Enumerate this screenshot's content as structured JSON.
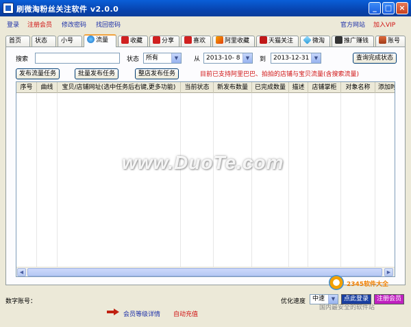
{
  "window": {
    "title": "刷微淘粉丝关注软件 v2.0.0"
  },
  "menu": {
    "login": "登录",
    "register": "注册会员",
    "change_password": "修改密码",
    "find_password": "找回密码",
    "official_site": "官方网站",
    "join_vip": "加入VIP"
  },
  "tabs": [
    {
      "label": "首页"
    },
    {
      "label": "状态"
    },
    {
      "label": "小号"
    },
    {
      "label": "流量"
    },
    {
      "label": "收藏"
    },
    {
      "label": "分享"
    },
    {
      "label": "喜欢"
    },
    {
      "label": "阿里收藏"
    },
    {
      "label": "天猫关注"
    },
    {
      "label": "微淘"
    },
    {
      "label": "推广赚钱"
    },
    {
      "label": "账号"
    }
  ],
  "filters": {
    "search_label": "搜索",
    "search_value": "",
    "status_label": "状态",
    "status_value": "所有",
    "from_label": "从",
    "from_date": "2013-10- 8",
    "to_label": "到",
    "to_date": "2013-12-31",
    "query_button": "查询完成状态"
  },
  "actions": {
    "publish_traffic": "发布流量任务",
    "batch_publish": "批量发布任务",
    "store_publish": "整店发布任务",
    "notice": "目前已支持阿里巴巴、拍拍的店铺与宝贝流量(含搜索流量)"
  },
  "table": {
    "columns": [
      "序号",
      "曲线",
      "宝贝/店铺网址(选中任务后右键,更多功能)",
      "当前状态",
      "新发布数量",
      "已完成数量",
      "描述",
      "店铺掌柜",
      "对象名称",
      "添加时"
    ]
  },
  "watermark": "www.DuoTe.com",
  "footer": {
    "digital_account_label": "数字账号：",
    "member_level": "会员等级详情",
    "auto_recharge": "自动充值",
    "speed_label": "优化速度",
    "speed_value": "中速",
    "click_login": "点此登录",
    "register_member": "注册会员",
    "logo_text": "2345软件大全",
    "logo_sub": "国内最安全的软件站"
  },
  "colors": {
    "link": "#1a2ea8",
    "red": "#d01010",
    "title_bar": "#0a5fd8"
  }
}
